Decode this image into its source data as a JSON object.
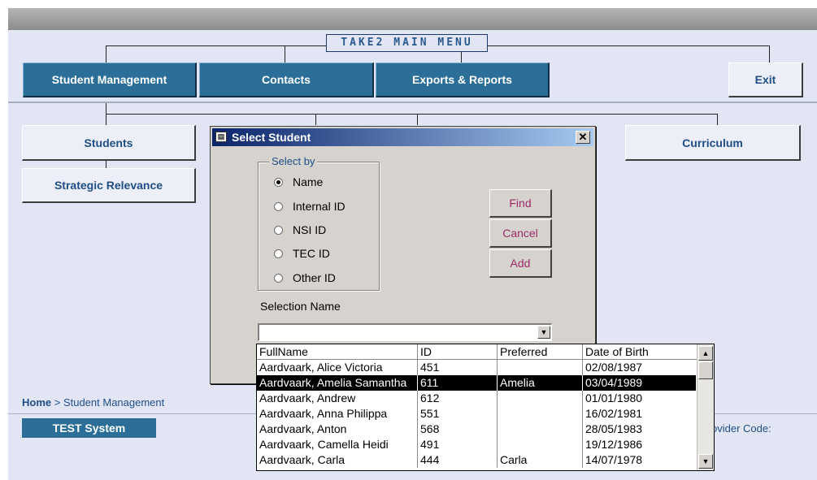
{
  "menu": {
    "title": "TAKE2 MAIN MENU",
    "nav": [
      "Student Management",
      "Contacts",
      "Exports & Reports"
    ],
    "exit": "Exit",
    "sub_left": [
      "Students",
      "Strategic Relevance"
    ],
    "sub_right": "Curriculum"
  },
  "footer": {
    "home": "Home",
    "crumb": " > Student Management",
    "system": "TEST System",
    "provider_partial": "ovider Code:"
  },
  "dialog": {
    "title": "Select Student",
    "group_label": "Select by",
    "options": [
      "Name",
      "Internal ID",
      "NSI ID",
      "TEC ID",
      "Other ID"
    ],
    "selected_option": "Name",
    "buttons": [
      "Find",
      "Cancel",
      "Add"
    ],
    "selection_label": "Selection Name",
    "selection_value": ""
  },
  "list": {
    "columns": [
      "FullName",
      "ID",
      "Preferred",
      "Date of Birth"
    ],
    "rows": [
      [
        "Aardvaark, Alice Victoria",
        "451",
        "",
        "02/08/1987"
      ],
      [
        "Aardvaark, Amelia Samantha",
        "611",
        "Amelia",
        "03/04/1989"
      ],
      [
        "Aardvaark, Andrew",
        "612",
        "",
        "01/01/1980"
      ],
      [
        "Aardvaark, Anna Philippa",
        "551",
        "",
        "16/02/1981"
      ],
      [
        "Aardvaark, Anton",
        "568",
        "",
        "28/05/1983"
      ],
      [
        "Aardvaark, Camella Heidi",
        "491",
        "",
        "19/12/1986"
      ],
      [
        "Aardvaark, Carla",
        "444",
        "Carla",
        "14/07/1978"
      ]
    ],
    "selected_row": 1
  }
}
